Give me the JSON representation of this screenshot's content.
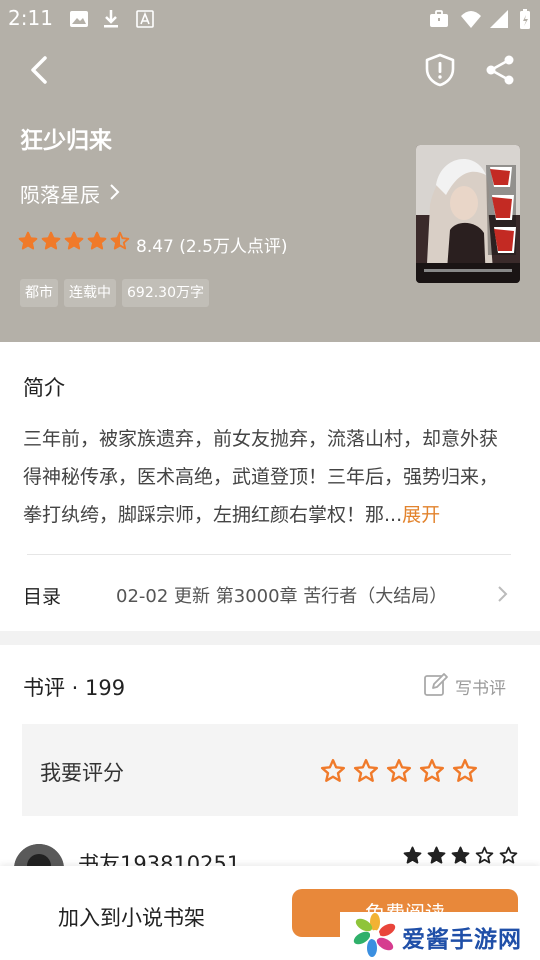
{
  "statusbar": {
    "time": "2:11"
  },
  "book": {
    "title": "狂少归来",
    "author": "陨落星辰",
    "rating_text": "8.47 (2.5万人点评)",
    "rating_stars": 4.5,
    "tags": [
      "都市",
      "连载中",
      "692.30万字"
    ]
  },
  "intro": {
    "title": "简介",
    "text": "三年前，被家族遗弃，前女友抛弃，流落山村，却意外获得神秘传承，医术高绝，武道登顶！三年后，强势归来，拳打纨绔，脚踩宗师，左拥红颜右掌权！那...",
    "more_label": "展开"
  },
  "toc": {
    "label": "目录",
    "update": "02-02  更新   第3000章 苦行者（大结局）"
  },
  "reviews": {
    "title": "书评 · 199",
    "write_label": "写书评",
    "rate_label": "我要评分",
    "first_user": "书友193810251",
    "first_user_stars": 3
  },
  "bottom": {
    "add_shelf_label": "加入到小说书架",
    "read_label": "免费阅读"
  },
  "watermark": {
    "text": "爱酱手游网"
  },
  "colors": {
    "accent": "#e8883a",
    "header_bg": "#b4b0a8",
    "more": "#e2832d",
    "star": "#f07a2a"
  }
}
